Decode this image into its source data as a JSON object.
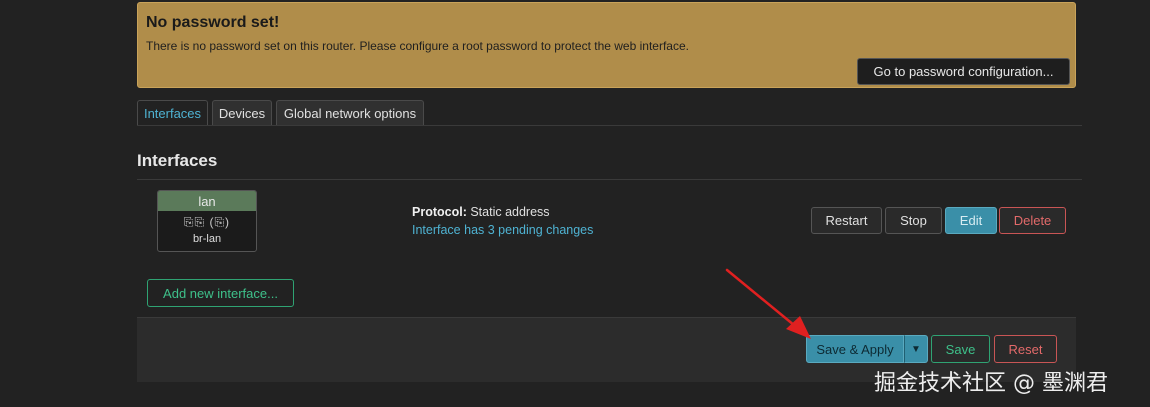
{
  "banner": {
    "title": "No password set!",
    "text": "There is no password set on this router. Please configure a root password to protect the web interface.",
    "button_label": "Go to password configuration..."
  },
  "tabs": [
    {
      "label": "Interfaces",
      "active": true
    },
    {
      "label": "Devices",
      "active": false
    },
    {
      "label": "Global network options",
      "active": false
    }
  ],
  "section": {
    "title": "Interfaces"
  },
  "interface": {
    "name": "lan",
    "icons": "⎘⎘ (⎘)",
    "device": "br-lan",
    "protocol_label": "Protocol:",
    "protocol_value": "Static address",
    "pending_text": "Interface has 3 pending changes",
    "actions": {
      "restart": "Restart",
      "stop": "Stop",
      "edit": "Edit",
      "delete": "Delete"
    }
  },
  "add_interface_label": "Add new interface...",
  "footer": {
    "save_apply_label": "Save & Apply",
    "dropdown_icon": "caret-down-icon",
    "save_label": "Save",
    "reset_label": "Reset"
  },
  "watermark": "掘金技术社区 @ 墨渊君",
  "colors": {
    "accent": "#3a8fa8",
    "banner": "#b08d4a",
    "danger": "#e36a6a",
    "success": "#3ec08a"
  }
}
